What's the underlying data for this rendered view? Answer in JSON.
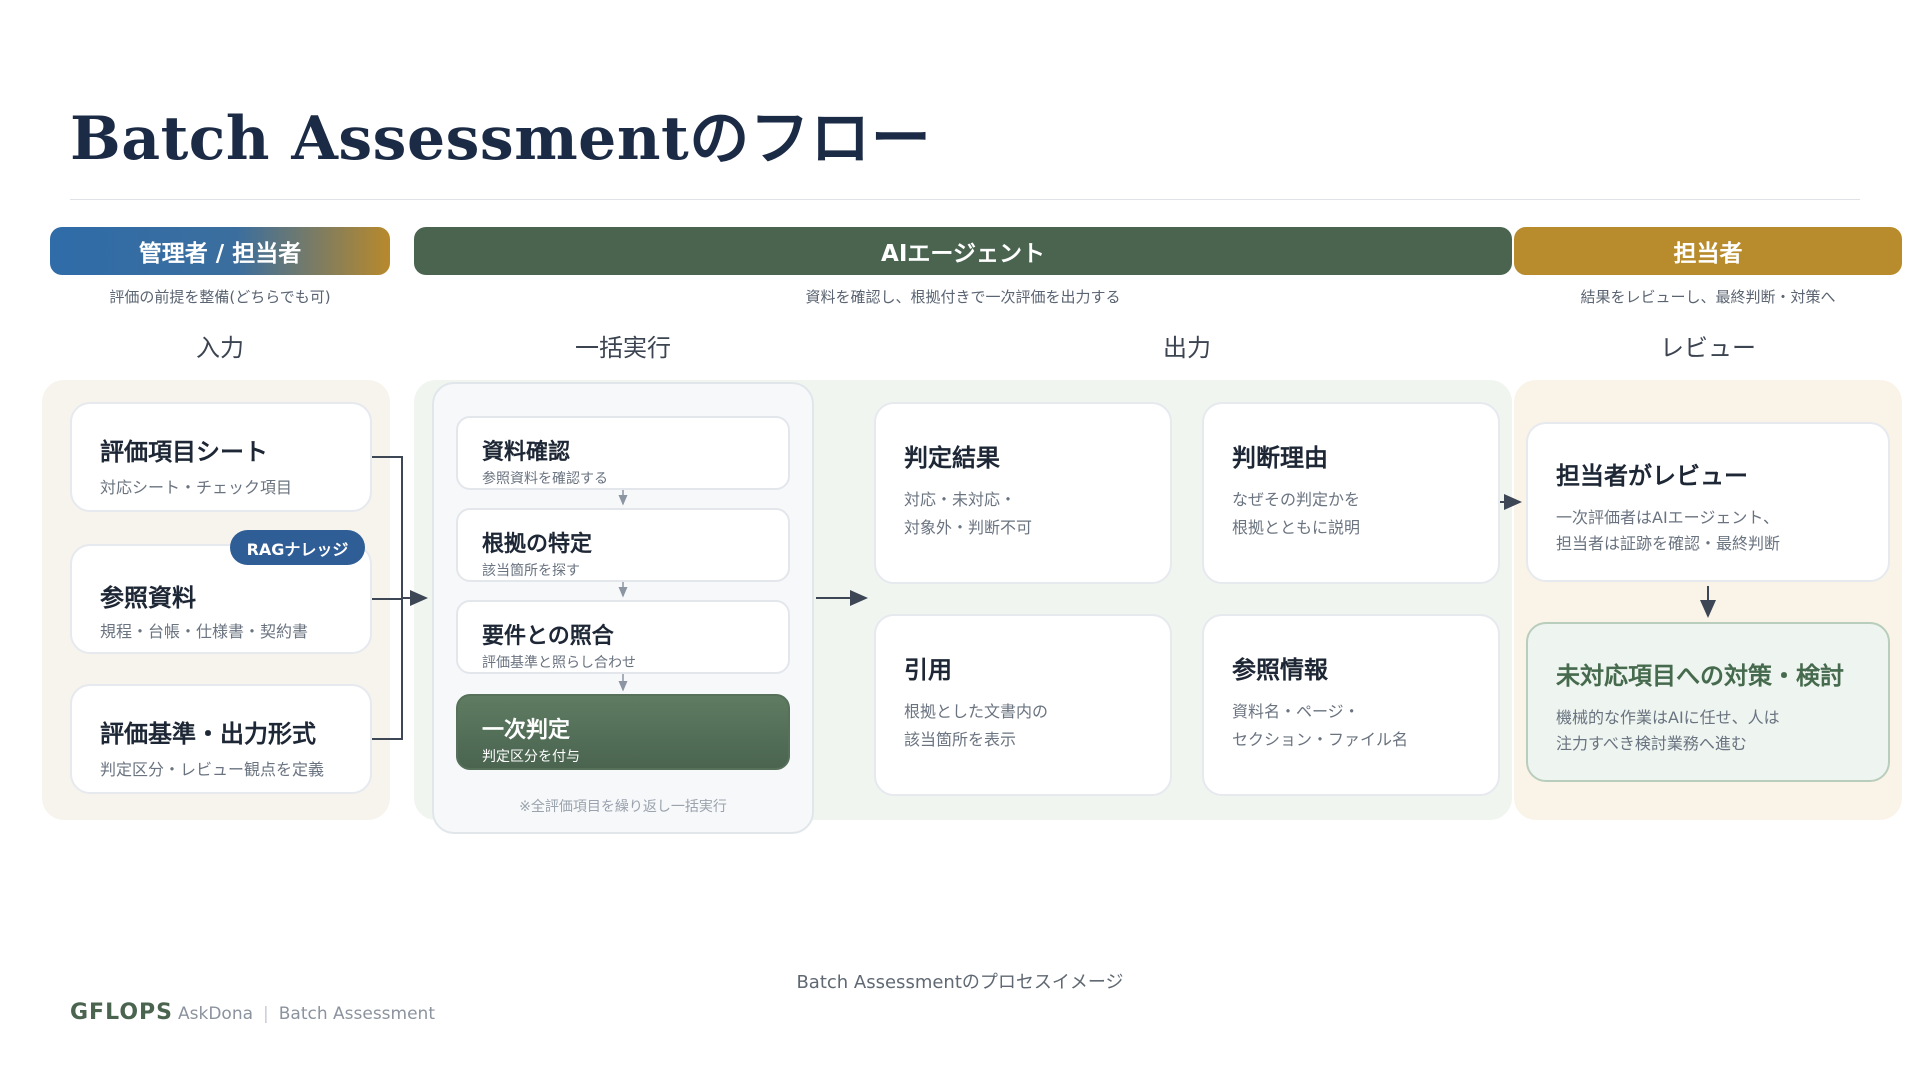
{
  "title": "Batch Assessmentのフロー",
  "bands": {
    "admin": "管理者 / 担当者",
    "ai": "AIエージェント",
    "staff": "担当者"
  },
  "subcaptions": {
    "admin": "評価の前提を整備(どちらでも可)",
    "ai": "資料を確認し、根拠付きで一次評価を出力する",
    "staff": "結果をレビューし、最終判断・対策へ"
  },
  "stages": {
    "input": "入力",
    "batch": "一括実行",
    "output": "出力",
    "review": "レビュー"
  },
  "input_cards": [
    {
      "title": "評価項目シート",
      "desc": "対応シート・チェック項目"
    },
    {
      "title": "参照資料",
      "desc": "規程・台帳・仕様書・契約書",
      "badge": "RAGナレッジ"
    },
    {
      "title": "評価基準・出力形式",
      "desc": "判定区分・レビュー観点を定義"
    }
  ],
  "batch_steps": [
    {
      "title": "資料確認",
      "desc": "参照資料を確認する"
    },
    {
      "title": "根拠の特定",
      "desc": "該当箇所を探す"
    },
    {
      "title": "要件との照合",
      "desc": "評価基準と照らし合わせ"
    },
    {
      "title": "一次判定",
      "desc": "判定区分を付与"
    }
  ],
  "batch_note": "※全評価項目を繰り返し一括実行",
  "output_cards": [
    {
      "title": "判定結果",
      "line1": "対応・未対応・",
      "line2": "対象外・判断不可"
    },
    {
      "title": "判断理由",
      "line1": "なぜその判定かを",
      "line2": "根拠とともに説明"
    },
    {
      "title": "引用",
      "line1": "根拠とした文書内の",
      "line2": "該当箇所を表示"
    },
    {
      "title": "参照情報",
      "line1": "資料名・ページ・",
      "line2": "セクション・ファイル名"
    }
  ],
  "review_cards": [
    {
      "title": "担当者がレビュー",
      "line1": "一次評価者はAIエージェント、",
      "line2": "担当者は証跡を確認・最終判断"
    },
    {
      "title": "未対応項目への対策・検討",
      "line1": "機械的な作業はAIに任せ、人は",
      "line2": "注力すべき検討業務へ進む"
    }
  ],
  "caption": "Batch Assessmentのプロセスイメージ",
  "footer": {
    "logo": "GFLOPS",
    "product": "AskDona",
    "separator": "|",
    "page": "Batch Assessment"
  }
}
